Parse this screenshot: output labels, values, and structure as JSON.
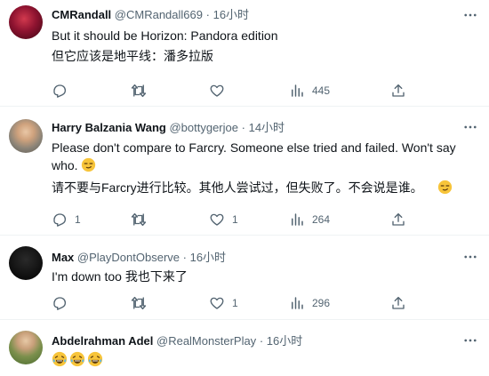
{
  "tweets": [
    {
      "name": "CMRandall",
      "handle": "@CMRandall669",
      "time": "16小时",
      "lines": [
        "But it should be Horizon: Pandora edition",
        "但它应该是地平线：潘多拉版"
      ],
      "replies": "",
      "retweets": "",
      "likes": "",
      "views": "445"
    },
    {
      "name": "Harry Balzania Wang",
      "handle": "@bottygerjoe",
      "time": "14小时",
      "lines": [
        "Please don't compare to Farcry. Someone else tried and failed. Won't say",
        "who.",
        "请不要与Farcry进行比较。其他人尝试过，但失败了。不会说是谁。"
      ],
      "replies": "1",
      "retweets": "",
      "likes": "1",
      "views": "264"
    },
    {
      "name": "Max",
      "handle": "@PlayDontObserve",
      "time": "16小时",
      "lines": [
        "I'm down too 我也下来了"
      ],
      "replies": "",
      "retweets": "",
      "likes": "1",
      "views": "296"
    },
    {
      "name": "Abdelrahman Adel",
      "handle": "@RealMonsterPlay",
      "time": "16小时"
    }
  ],
  "separator": "·",
  "icons": {
    "reply": "reply-icon",
    "retweet": "retweet-icon",
    "like": "heart-icon",
    "views": "views-icon",
    "share": "share-icon",
    "more": "more-icon",
    "emoji_smirk": "smirk-emoji-icon",
    "emoji_laugh": "laughing-tears-emoji-icon"
  },
  "colors": {
    "text": "#0f1419",
    "muted": "#536471",
    "divider": "#eff3f4",
    "emoji": "#f7c43a"
  }
}
